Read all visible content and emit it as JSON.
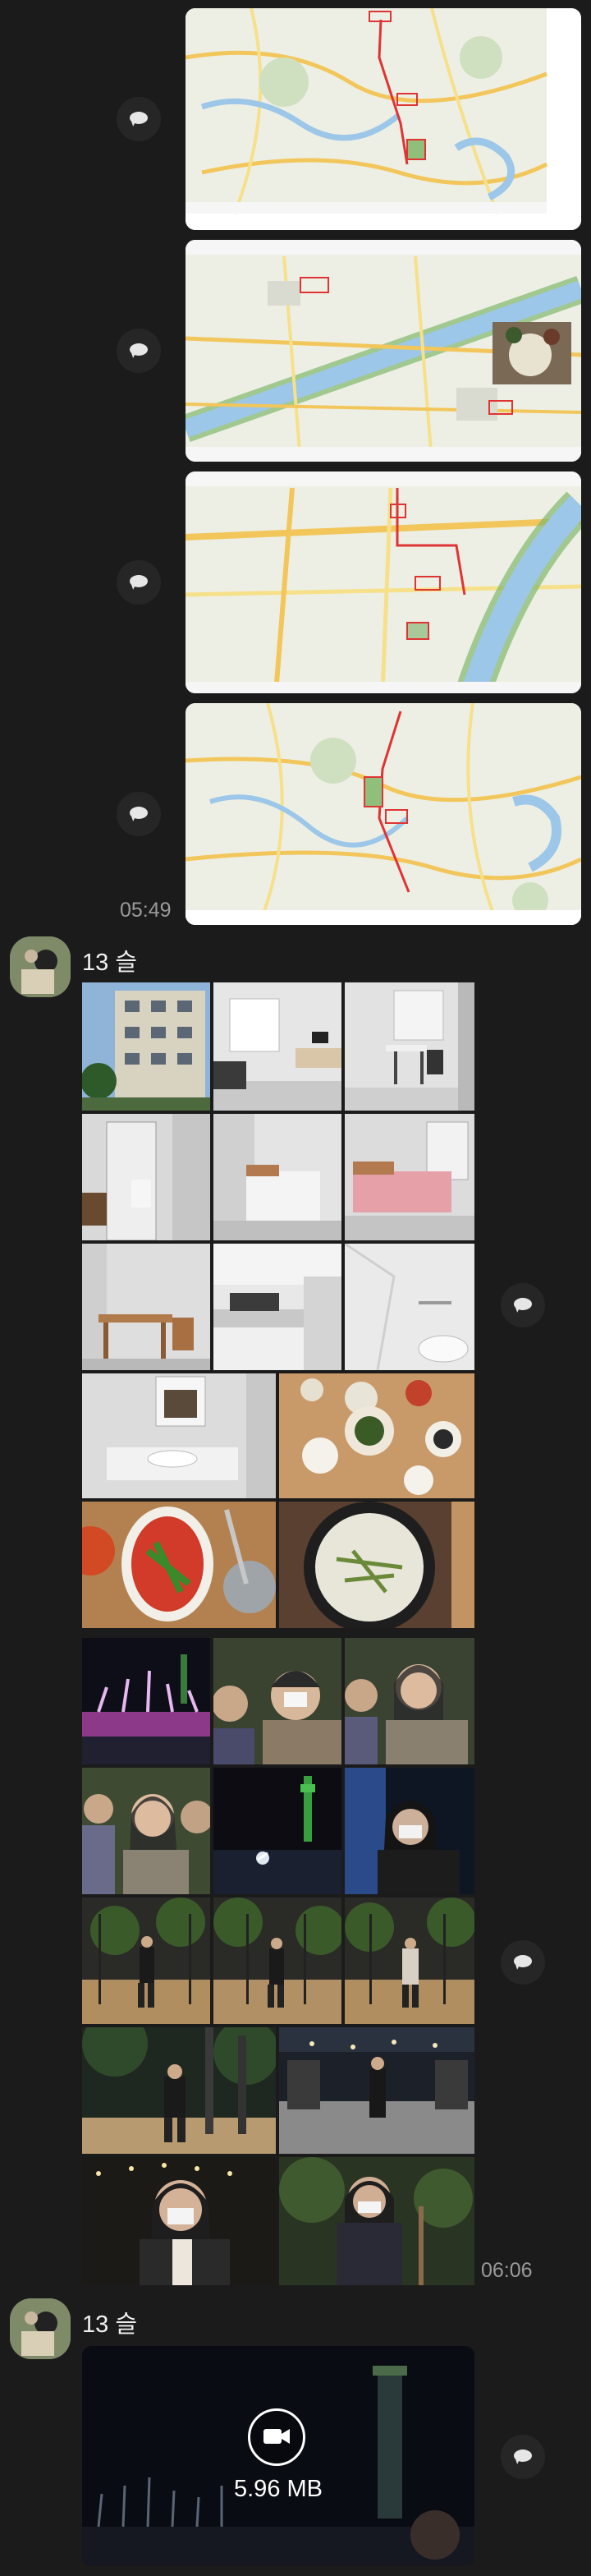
{
  "messages": [
    {
      "time": "05:49"
    },
    {
      "sender": "13 슬",
      "time": "06:06"
    },
    {
      "sender": "13 슬",
      "video_size": "5.96 MB"
    }
  ],
  "icons": {
    "share": "speech-bubble-icon",
    "video": "video-camera-icon"
  },
  "colors": {
    "background": "#1b1b1b",
    "time_text": "#9a9a9a",
    "map_route": "#e03333"
  }
}
